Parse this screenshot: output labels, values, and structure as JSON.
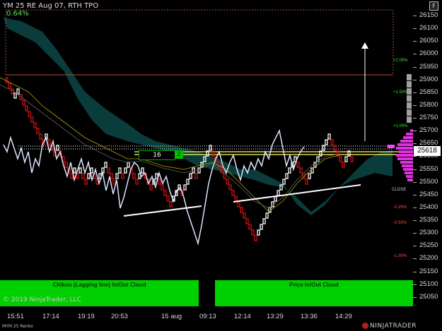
{
  "header": {
    "title": "YM 25 RE Aug 07, RTH TPO",
    "change_pct": "0.64%"
  },
  "window_button": "F",
  "price_axis": {
    "ticks": [
      "26150",
      "26100",
      "26050",
      "26000",
      "25950",
      "25900",
      "25850",
      "25800",
      "25750",
      "25700",
      "25650",
      "25600",
      "25550",
      "25500",
      "25450",
      "25400",
      "25350",
      "25300",
      "25250",
      "25200",
      "25150",
      "25100",
      "25050"
    ],
    "current_price": "25618"
  },
  "time_axis": {
    "labels": [
      "15:51",
      "17:14",
      "19:19",
      "20:53",
      "15 aug",
      "09:13",
      "12:14",
      "13:29",
      "13:36",
      "14:29"
    ]
  },
  "level_labels": [
    {
      "text": "+2.00%",
      "color": "#40e040"
    },
    {
      "text": "+1.50%",
      "color": "#40e040"
    },
    {
      "text": "+1.00%",
      "color": "#40e040"
    },
    {
      "text": "CLOSE",
      "color": "#c8c8c8"
    },
    {
      "text": "-0.25%",
      "color": "#ff5040"
    },
    {
      "text": "-0.50%",
      "color": "#ff5040"
    },
    {
      "text": "-1.00%",
      "color": "#ff5040"
    },
    {
      "text": "-1.50%",
      "color": "#ff5040"
    }
  ],
  "indicator_boxes": {
    "count": "16",
    "sub": "2"
  },
  "panels": {
    "left": "Chikou (Lagging line) In/Out Cloud",
    "right": "Price In/Out Cloud"
  },
  "footer": {
    "copyright": "© 2019 NinjaTrader, LLC",
    "symbol": "MYM 25 Renko",
    "brand": "NINJATRADER"
  },
  "colors": {
    "cloud": "#0b3c3c",
    "up_bar": "#ffffff",
    "down_bar": "#d01010",
    "chikou": "#dde4ff",
    "panel": "#00d000"
  }
}
